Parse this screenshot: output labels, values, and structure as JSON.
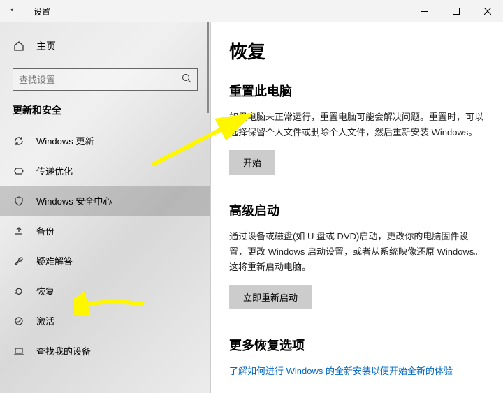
{
  "titlebar": {
    "title": "设置"
  },
  "sidebar": {
    "home": "主页",
    "search_placeholder": "查找设置",
    "section": "更新和安全",
    "items": [
      {
        "label": "Windows 更新"
      },
      {
        "label": "传递优化"
      },
      {
        "label": "Windows 安全中心"
      },
      {
        "label": "备份"
      },
      {
        "label": "疑难解答"
      },
      {
        "label": "恢复"
      },
      {
        "label": "激活"
      },
      {
        "label": "查找我的设备"
      }
    ]
  },
  "content": {
    "heading": "恢复",
    "reset": {
      "title": "重置此电脑",
      "desc": "如果电脑未正常运行，重置电脑可能会解决问题。重置时，可以选择保留个人文件或删除个人文件，然后重新安装 Windows。",
      "button": "开始"
    },
    "advanced": {
      "title": "高级启动",
      "desc": "通过设备或磁盘(如 U 盘或 DVD)启动，更改你的电脑固件设置，更改 Windows 启动设置，或者从系统映像还原 Windows。 这将重新启动电脑。",
      "button": "立即重新启动"
    },
    "more": {
      "title": "更多恢复选项",
      "link": "了解如何进行 Windows 的全新安装以便开始全新的体验"
    }
  }
}
